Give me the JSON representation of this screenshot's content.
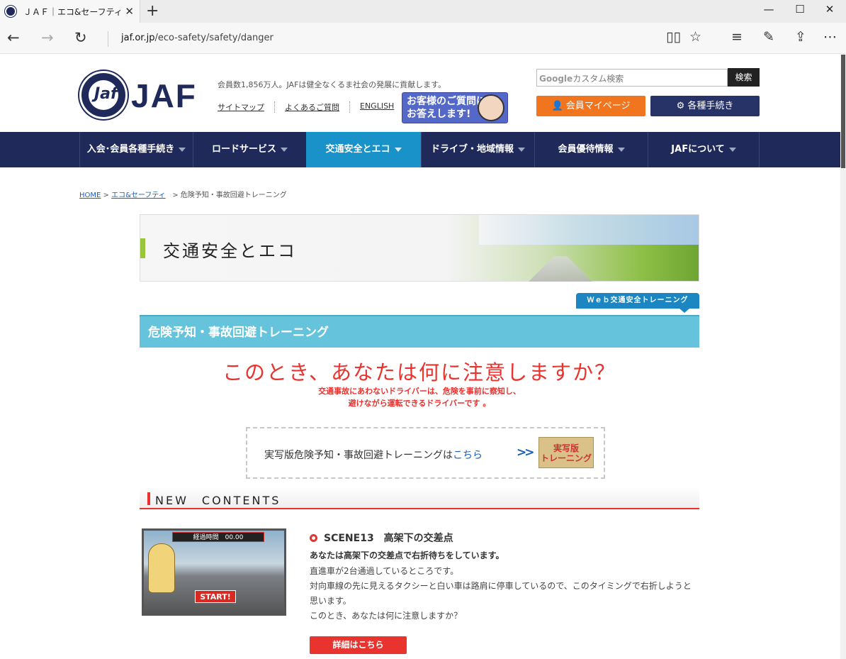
{
  "browser": {
    "tab_title": "ＪＡＦ｜エコ&セーフティ｜",
    "url_host": "jaf.or.jp",
    "url_path": "/eco-safety/safety/danger"
  },
  "header": {
    "logo_text": "JAF",
    "tagline": "会員数1,856万人。JAFは健全なくるま社会の発展に貢献します。",
    "links": [
      "サイトマップ",
      "よくあるご質問",
      "ENGLISH"
    ],
    "qa_banner": [
      "お客様のご質問に",
      "お答えします!"
    ],
    "search": {
      "brand": "Google",
      "placeholder": "カスタム検索",
      "button": "検索"
    },
    "mypage_button": "会員マイページ",
    "procedures_button": "各種手続き"
  },
  "nav": {
    "items": [
      "入会･会員各種手続き",
      "ロードサービス",
      "交通安全とエコ",
      "ドライブ・地域情報",
      "会員優待情報",
      "JAFについて"
    ],
    "active_index": 2
  },
  "breadcrumb": {
    "home": "HOME",
    "eco": "エコ&セーフティ",
    "current": "危険予知・事故回避トレーニング"
  },
  "hero": {
    "title": "交通安全とエコ"
  },
  "web_tag": "Ｗｅｂ交通安全トレーニング",
  "section_title": "危険予知・事故回避トレーニング",
  "question": "このとき、あなたは何に注意しますか？",
  "subtext": [
    "交通事故にあわないドライバーは、危険を事前に察知し、",
    "避けながら運転できるドライバーです 。"
  ],
  "promo": {
    "text": "実写版危険予知・事故回避トレーニングは",
    "link": "こちら",
    "badge_top": "実写版",
    "badge_bottom": "トレーニング"
  },
  "new_contents": {
    "title": "NEW　CONTENTS"
  },
  "scene": {
    "thumb_timer": "経過時間　00.00",
    "thumb_start": "START!",
    "title": "SCENE13　高架下の交差点",
    "lead": "あなたは高架下の交差点で右折待ちをしています。",
    "body": [
      "直進車が2台通過しているところです。",
      "対向車線の先に見えるタクシーと白い車は路肩に停車しているので、このタイミングで右折しようと思います。",
      "このとき、あなたは何に注意しますか？"
    ],
    "button": "詳細はこちら"
  }
}
